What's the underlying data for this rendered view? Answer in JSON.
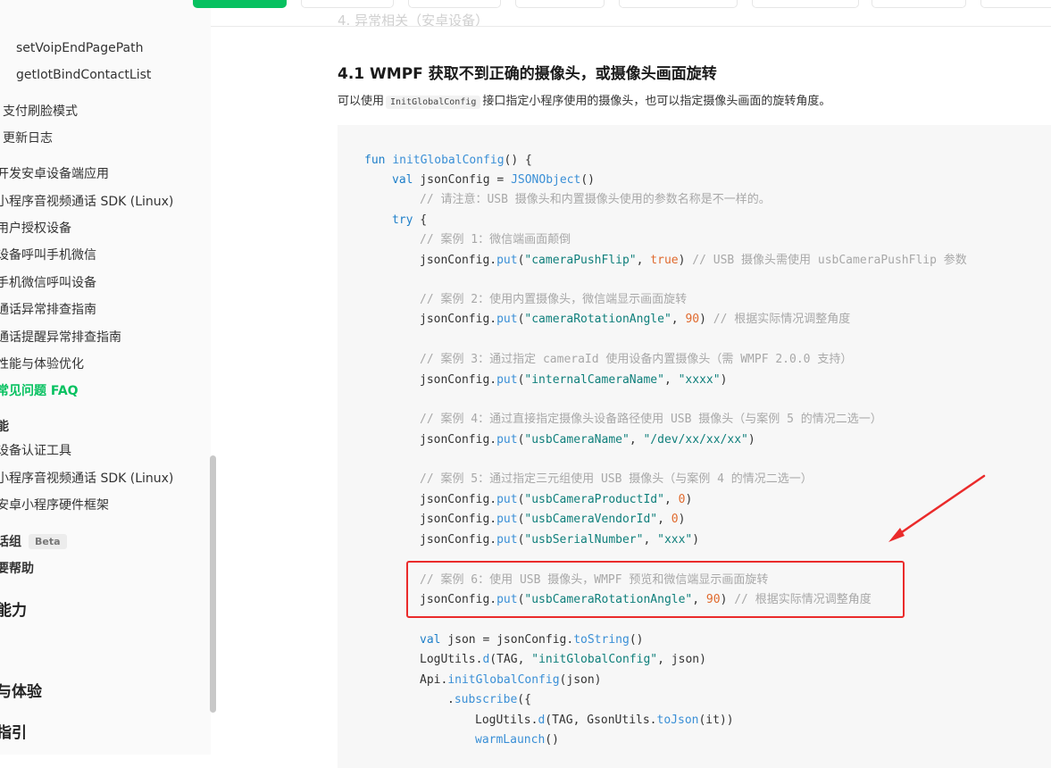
{
  "sidebar": {
    "items": [
      {
        "label": "setVoipEndPagePath"
      },
      {
        "label": "getIotBindContactList"
      },
      {
        "label": "支付刷脸模式"
      },
      {
        "label": "更新日志"
      },
      {
        "label": "开发安卓设备端应用"
      },
      {
        "label": "小程序音视频通话 SDK (Linux)"
      },
      {
        "label": "用户授权设备"
      },
      {
        "label": "设备呼叫手机微信"
      },
      {
        "label": "手机微信呼叫设备"
      },
      {
        "label": "通话异常排查指南"
      },
      {
        "label": "通话提醒异常排查指南"
      },
      {
        "label": "性能与体验优化"
      },
      {
        "label": "常见问题 FAQ"
      },
      {
        "label": "能"
      },
      {
        "label": "设备认证工具"
      },
      {
        "label": "小程序音视频通话 SDK (Linux)"
      },
      {
        "label": "安卓小程序硬件框架"
      },
      {
        "label": "话组",
        "badge": "Beta"
      },
      {
        "label": "要帮助"
      },
      {
        "label": "能力"
      },
      {
        "label": "与体验"
      },
      {
        "label": "指引"
      }
    ]
  },
  "content": {
    "faded_heading": "4. 异常相关（安卓设备）",
    "section_title": "4.1 WMPF 获取不到正确的摄像头，或摄像头画面旋转",
    "desc_before": "可以使用",
    "desc_code": "InitGlobalConfig",
    "desc_after": "接口指定小程序使用的摄像头，也可以指定摄像头画面的旋转角度。"
  },
  "code": {
    "fun_kw": "fun",
    "fun_name": "initGlobalConfig",
    "fun_rest": "() {",
    "val_kw": "val",
    "val_name": " jsonConfig = ",
    "val_cls": "JSONObject",
    "val_rest": "()",
    "note": "// 请注意：USB 摄像头和内置摄像头使用的参数名称是不一样的。",
    "try_kw": "try",
    "try_rest": " {",
    "c1_comment": "// 案例 1：微信端画面颠倒",
    "c1_key": "\"cameraPushFlip\"",
    "c1_val": "true",
    "c1_note": "// USB 摄像头需使用 usbCameraPushFlip 参数",
    "c2_comment": "// 案例 2：使用内置摄像头，微信端显示画面旋转",
    "c2_key": "\"cameraRotationAngle\"",
    "c2_val": "90",
    "c2_note": "// 根据实际情况调整角度",
    "c3_comment": "// 案例 3：通过指定 cameraId 使用设备内置摄像头（需 WMPF 2.0.0 支持）",
    "c3_key": "\"internalCameraName\"",
    "c3_val": "\"xxxx\"",
    "c4_comment": "// 案例 4：通过直接指定摄像头设备路径使用 USB 摄像头（与案例 5 的情况二选一）",
    "c4_key": "\"usbCameraName\"",
    "c4_val": "\"/dev/xx/xx/xx\"",
    "c5_comment": "// 案例 5：通过指定三元组使用 USB 摄像头（与案例 4 的情况二选一）",
    "c5_key1": "\"usbCameraProductId\"",
    "c5_val1": "0",
    "c5_key2": "\"usbCameraVendorId\"",
    "c5_val2": "0",
    "c5_key3": "\"usbSerialNumber\"",
    "c5_val3": "\"xxx\"",
    "c6_comment": "// 案例 6：使用 USB 摄像头，WMPF 预览和微信端显示画面旋转",
    "c6_key": "\"usbCameraRotationAngle\"",
    "c6_val": "90",
    "c6_note": "// 根据实际情况调整角度",
    "obj": "jsonConfig.",
    "put": "put",
    "json_val": "val",
    "json_name": " json = jsonConfig.",
    "json_fn": "toString",
    "json_rest": "()",
    "log_obj": "LogUtils.",
    "log_fn": "d",
    "log_args1": "(TAG, ",
    "log_str": "\"initGlobalConfig\"",
    "log_args2": ", json)",
    "api_obj": "Api.",
    "api_fn": "initGlobalConfig",
    "api_rest": "(json)",
    "sub_dot": ".",
    "sub_fn": "subscribe",
    "sub_rest": "({",
    "log2_obj": "LogUtils.",
    "log2_fn": "d",
    "log2_args": "(TAG, GsonUtils.",
    "log2_fn2": "toJson",
    "log2_rest": "(it))",
    "warm_fn": "warmLaunch",
    "warm_rest": "()"
  },
  "colors": {
    "accent": "#07c160",
    "highlight_box": "#ea2b2b",
    "arrow": "#ea2b2b"
  }
}
